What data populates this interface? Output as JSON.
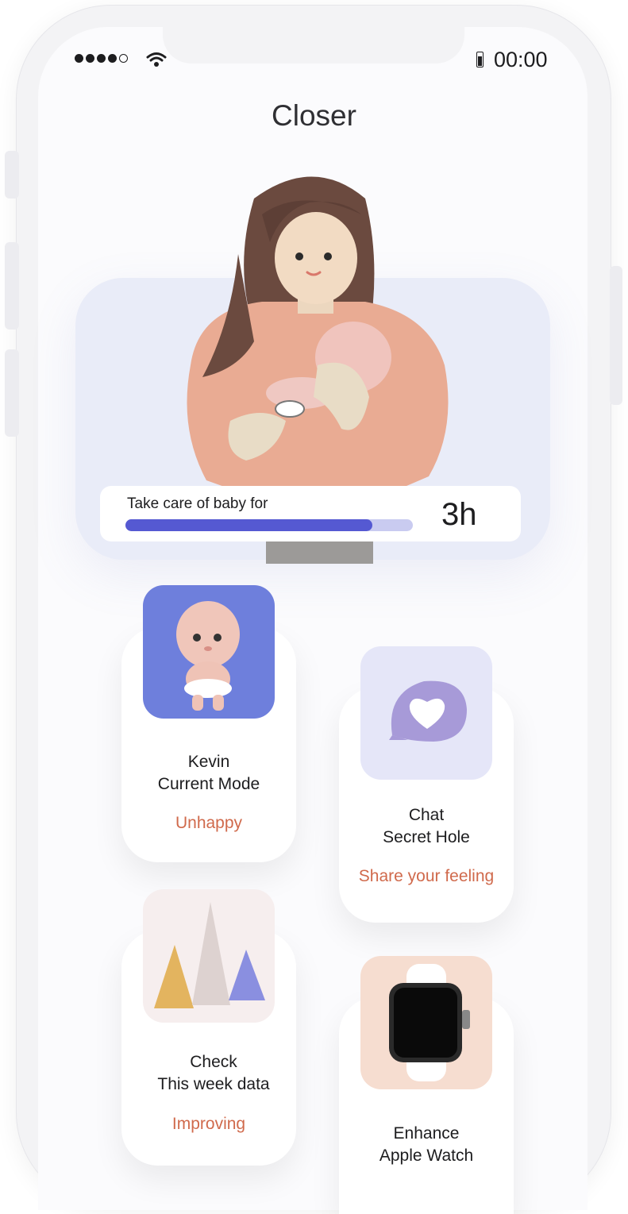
{
  "status_bar": {
    "time": "00:00"
  },
  "app": {
    "title": "Closer"
  },
  "hero": {
    "progress_label": "Take care of baby for",
    "progress_value": "3h",
    "progress_fraction": 0.86
  },
  "cards": {
    "kevin": {
      "line1": "Kevin",
      "line2": "Current Mode",
      "status": "Unhappy"
    },
    "chat": {
      "line1": "Chat",
      "line2": "Secret Hole",
      "status": "Share your feeling"
    },
    "check": {
      "line1": "Check",
      "line2": "This week data",
      "status": "Improving"
    },
    "enhance": {
      "line1": "Enhance",
      "line2": "Apple Watch"
    }
  },
  "colors": {
    "accent": "#5559d2",
    "status_text": "#d06a4c",
    "kevin_thumb_bg": "#6e7fdc",
    "chat_thumb_bg": "#e5e6f8",
    "check_thumb_bg": "#f6eeee",
    "watch_thumb_bg": "#f6ddd0"
  },
  "icons": [
    "signal-dots-icon",
    "wifi-icon",
    "battery-icon",
    "heart-chat-bubble-icon",
    "mountain-chart-icon",
    "apple-watch-icon",
    "baby-avatar-icon"
  ]
}
